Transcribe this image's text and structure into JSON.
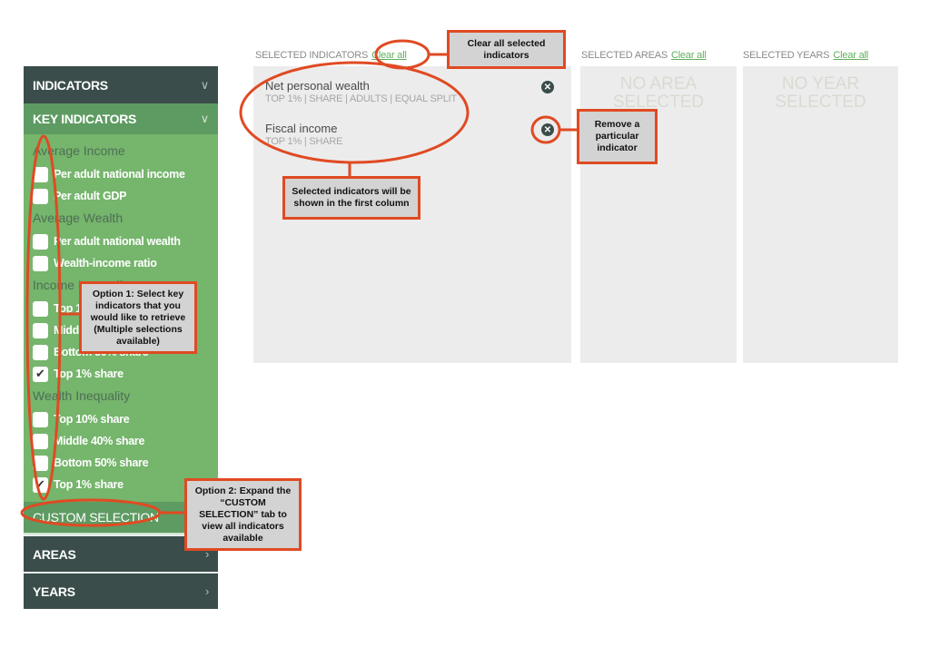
{
  "sidebar": {
    "indicators_header": "INDICATORS",
    "key_indicators_header": "KEY INDICATORS",
    "groups": [
      {
        "title": "Average Income",
        "items": [
          {
            "label": "Per adult national income",
            "checked": false
          },
          {
            "label": "Per adult GDP",
            "checked": false
          }
        ]
      },
      {
        "title": "Average Wealth",
        "items": [
          {
            "label": "Per adult national wealth",
            "checked": false
          },
          {
            "label": "Wealth-income ratio",
            "checked": false
          }
        ]
      },
      {
        "title": "Income Inequality",
        "items": [
          {
            "label": "Top 10% share",
            "checked": false
          },
          {
            "label": "Middle 40% share",
            "checked": false
          },
          {
            "label": "Bottom 50% share",
            "checked": false
          },
          {
            "label": "Top 1% share",
            "checked": true
          }
        ]
      },
      {
        "title": "Wealth Inequality",
        "items": [
          {
            "label": "Top 10% share",
            "checked": false
          },
          {
            "label": "Middle 40% share",
            "checked": false
          },
          {
            "label": "Bottom 50% share",
            "checked": false
          },
          {
            "label": "Top 1% share",
            "checked": true
          }
        ]
      }
    ],
    "custom_selection": "CUSTOM SELECTION",
    "areas": "AREAS",
    "years": "YEARS",
    "icons": {
      "expand": "chevron-down-icon",
      "collapsed": "chevron-right-icon"
    }
  },
  "columns": {
    "indicators": {
      "label": "SELECTED INDICATORS",
      "clear": "Clear all",
      "items": [
        {
          "name": "Net personal wealth",
          "sub": "TOP 1% | SHARE | ADULTS | EQUAL SPLIT"
        },
        {
          "name": "Fiscal income",
          "sub": "TOP 1% | SHARE"
        }
      ]
    },
    "areas": {
      "label": "SELECTED AREAS",
      "clear": "Clear all",
      "empty": "NO AREA SELECTED"
    },
    "years": {
      "label": "SELECTED YEARS",
      "clear": "Clear all",
      "empty": "NO YEAR SELECTED"
    }
  },
  "annotations": {
    "clear_all": "Clear all selected indicators",
    "remove": "Remove a particular indicator",
    "shown": "Selected indicators will be shown in the first column",
    "option1": "Option 1: Select key indicators that you would like to retrieve (Multiple selections available)",
    "option2": "Option 2: Expand the “CUSTOM SELECTION” tab to view all indicators available"
  },
  "colors": {
    "accent": "#e04a23",
    "sidebar_dark": "#3a4d4a",
    "sidebar_green": "#75b56c",
    "link": "#5fae5c"
  }
}
